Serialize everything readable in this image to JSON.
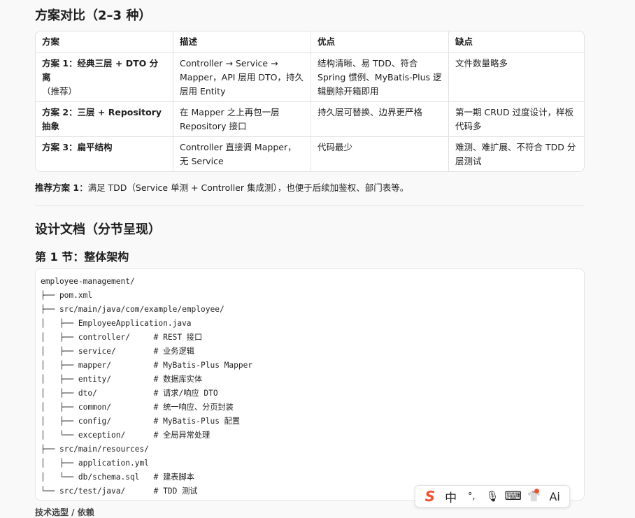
{
  "section1": {
    "title": "方案对比（2–3 种）",
    "table": {
      "headers": [
        "方案",
        "描述",
        "优点",
        "缺点"
      ],
      "rows": [
        {
          "plan": "方案 1：经典三层 + DTO 分离",
          "plan_note": "（推荐）",
          "desc": "Controller → Service → Mapper，API 层用 DTO，持久层用 Entity",
          "pros": "结构清晰、易 TDD、符合 Spring 惯例、MyBatis-Plus 逻辑删除开箱即用",
          "cons": "文件数量略多"
        },
        {
          "plan": "方案 2：三层 + Repository 抽象",
          "plan_note": "",
          "desc": "在 Mapper 之上再包一层 Repository 接口",
          "pros": "持久层可替换、边界更严格",
          "cons": "第一期 CRUD 过度设计，样板代码多"
        },
        {
          "plan": "方案 3：扁平结构",
          "plan_note": "",
          "desc": "Controller 直接调 Mapper，无 Service",
          "pros": "代码最少",
          "cons": "难测、难扩展、不符合 TDD 分层测试"
        }
      ]
    },
    "recommend_label": "推荐方案 1",
    "recommend_text": "：满足 TDD（Service 单测 + Controller 集成测），也便于后续加鉴权、部门表等。"
  },
  "section2": {
    "title": "设计文档（分节呈现）",
    "subtitle": "第 1 节：整体架构",
    "code_lines": [
      "employee-management/",
      "├── pom.xml",
      "├── src/main/java/com/example/employee/",
      "│   ├── EmployeeApplication.java",
      "│   ├── controller/     # REST 接口",
      "│   ├── service/        # 业务逻辑",
      "│   ├── mapper/         # MyBatis-Plus Mapper",
      "│   ├── entity/         # 数据库实体",
      "│   ├── dto/            # 请求/响应 DTO",
      "│   ├── common/         # 统一响应、分页封装",
      "│   ├── config/         # MyBatis-Plus 配置",
      "│   └── exception/      # 全局异常处理",
      "├── src/main/resources/",
      "│   ├── application.yml",
      "│   └── db/schema.sql   # 建表脚本",
      "└── src/test/java/      # TDD 测试"
    ],
    "next_heading_partial": "技术选型 / 依赖"
  },
  "ime_toolbar": {
    "items": [
      {
        "name": "sogou-logo-icon",
        "glyph": "S",
        "color": "#f0522c"
      },
      {
        "name": "chinese-mode-icon",
        "glyph": "中",
        "color": "#222222"
      },
      {
        "name": "punctuation-icon",
        "glyph": "°,",
        "color": "#222222"
      },
      {
        "name": "microphone-icon",
        "glyph": "🎙",
        "color": "#222222"
      },
      {
        "name": "keyboard-icon",
        "glyph": "⌨",
        "color": "#222222"
      },
      {
        "name": "skin-shirt-icon",
        "glyph": "👕",
        "color": "#222222"
      },
      {
        "name": "ai-assistant-icon",
        "glyph": "Ai",
        "color": "#222222"
      }
    ]
  }
}
